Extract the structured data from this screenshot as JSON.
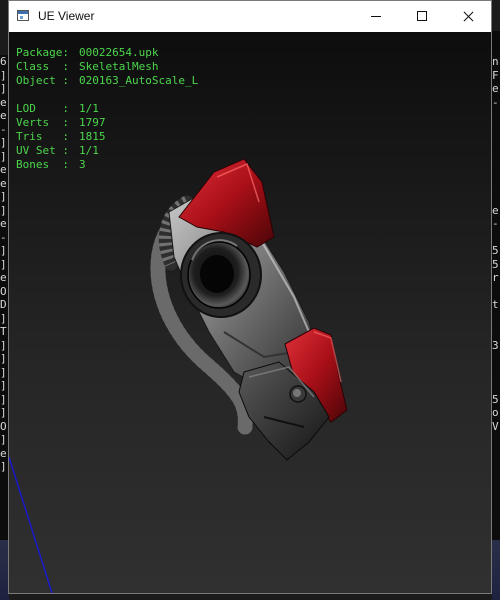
{
  "window": {
    "title": "UE Viewer"
  },
  "info": {
    "package": {
      "label": "Package:",
      "value": "00022654.upk"
    },
    "class": {
      "label": "Class  :",
      "value": "SkeletalMesh"
    },
    "object": {
      "label": "Object :",
      "value": "020163_AutoScale_L"
    },
    "lod": {
      "label": "LOD    :",
      "value": "1/1"
    },
    "verts": {
      "label": "Verts  :",
      "value": "1797"
    },
    "tris": {
      "label": "Tris   :",
      "value": "1815"
    },
    "uvset": {
      "label": "UV Set :",
      "value": "1/1"
    },
    "bones": {
      "label": "Bones  :",
      "value": "3"
    }
  },
  "background": {
    "left_console": "6\n]\n]\ne\ne\n-\n]\n]\ne\ne\n]\n]\ne\n-\n]\n]\ne\nO\nD\n]\nT\n]\n]\n]\n]\n]\n]\nO\n]\ne\n]",
    "right_console": "n\nF\ne\n-\n\n\n\n\n\n\n\ne\n-\n\n5\n5\nr\n\nt\n\n\n3\n\n\n\n5\no\nV"
  },
  "colors": {
    "info_text": "#4cd64c",
    "armor_red": "#b8141c",
    "armor_metal": "#8a8a8a",
    "axis_line": "#1a1acc"
  }
}
